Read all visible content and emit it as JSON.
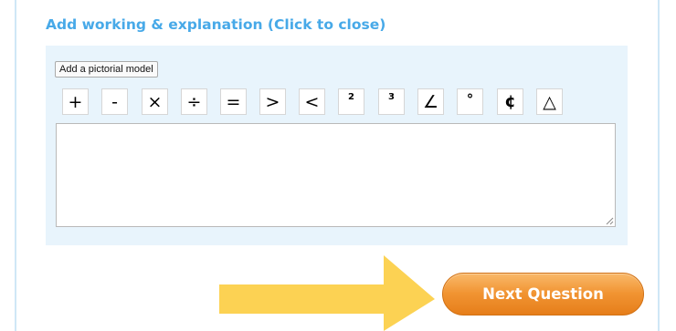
{
  "working_section": {
    "toggle_label": "Add working & explanation (Click to close)",
    "pictorial_button_label": "Add a pictorial model",
    "symbol_buttons": [
      {
        "label": "+",
        "name": "plus-button"
      },
      {
        "label": "-",
        "name": "minus-button"
      },
      {
        "label": "×",
        "name": "multiply-button"
      },
      {
        "label": "÷",
        "name": "divide-button"
      },
      {
        "label": "=",
        "name": "equals-button"
      },
      {
        "label": ">",
        "name": "greater-than-button"
      },
      {
        "label": "<",
        "name": "less-than-button"
      },
      {
        "label": "2",
        "name": "squared-button"
      },
      {
        "label": "3",
        "name": "cubed-button"
      },
      {
        "label": "∠",
        "name": "angle-button"
      },
      {
        "label": "°",
        "name": "degree-button"
      },
      {
        "label": "¢",
        "name": "cent-button"
      },
      {
        "label": "△",
        "name": "triangle-button"
      }
    ],
    "answer_text": ""
  },
  "navigation": {
    "next_button_label": "Next Question"
  },
  "colors": {
    "header_blue": "#47a9e8",
    "panel_bg": "#e8f4fc",
    "next_button_orange": "#f19432",
    "arrow_yellow": "#fcd253"
  },
  "icons": {
    "arrow": "right-arrow-icon",
    "resize_grip": "resize-grip-icon"
  }
}
